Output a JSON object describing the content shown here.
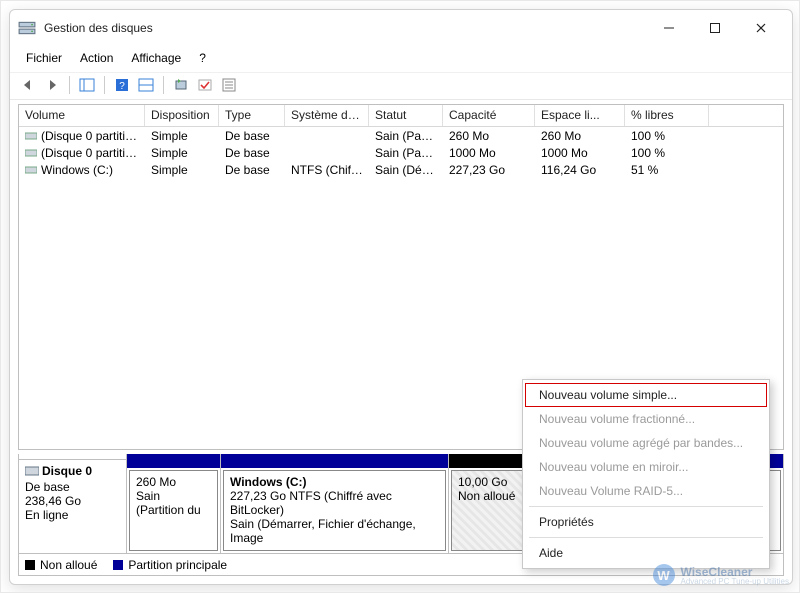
{
  "window": {
    "title": "Gestion des disques"
  },
  "menu": [
    "Fichier",
    "Action",
    "Affichage",
    "?"
  ],
  "columns": [
    "Volume",
    "Disposition",
    "Type",
    "Système de ...",
    "Statut",
    "Capacité",
    "Espace li...",
    "% libres"
  ],
  "volumes": [
    {
      "name": "(Disque 0 partition...",
      "layout": "Simple",
      "type": "De base",
      "fs": "",
      "status": "Sain (Parti...",
      "capacity": "260 Mo",
      "free": "260 Mo",
      "pct": "100 %"
    },
    {
      "name": "(Disque 0 partition...",
      "layout": "Simple",
      "type": "De base",
      "fs": "",
      "status": "Sain (Parti...",
      "capacity": "1000 Mo",
      "free": "1000 Mo",
      "pct": "100 %"
    },
    {
      "name": "Windows (C:)",
      "layout": "Simple",
      "type": "De base",
      "fs": "NTFS (Chiffr...",
      "status": "Sain (Dém...",
      "capacity": "227,23 Go",
      "free": "116,24 Go",
      "pct": "51 %"
    }
  ],
  "disk": {
    "name": "Disque 0",
    "type": "De base",
    "capacity": "238,46 Go",
    "status": "En ligne",
    "parts": [
      {
        "size": "260 Mo",
        "status": "Sain (Partition du"
      },
      {
        "title": "Windows  (C:)",
        "line2": "227,23 Go NTFS (Chiffré avec BitLocker)",
        "line3": "Sain (Démarrer, Fichier d'échange, Image"
      },
      {
        "size": "10,00 Go",
        "status": "Non alloué"
      }
    ]
  },
  "legend": [
    "Non alloué",
    "Partition principale"
  ],
  "ctx": [
    "Nouveau volume simple...",
    "Nouveau volume fractionné...",
    "Nouveau volume agrégé par bandes...",
    "Nouveau volume en miroir...",
    "Nouveau Volume RAID-5...",
    "Propriétés",
    "Aide"
  ],
  "watermark": {
    "brand": "WiseCleaner",
    "tag": "Advanced PC Tune-up Utilities"
  }
}
